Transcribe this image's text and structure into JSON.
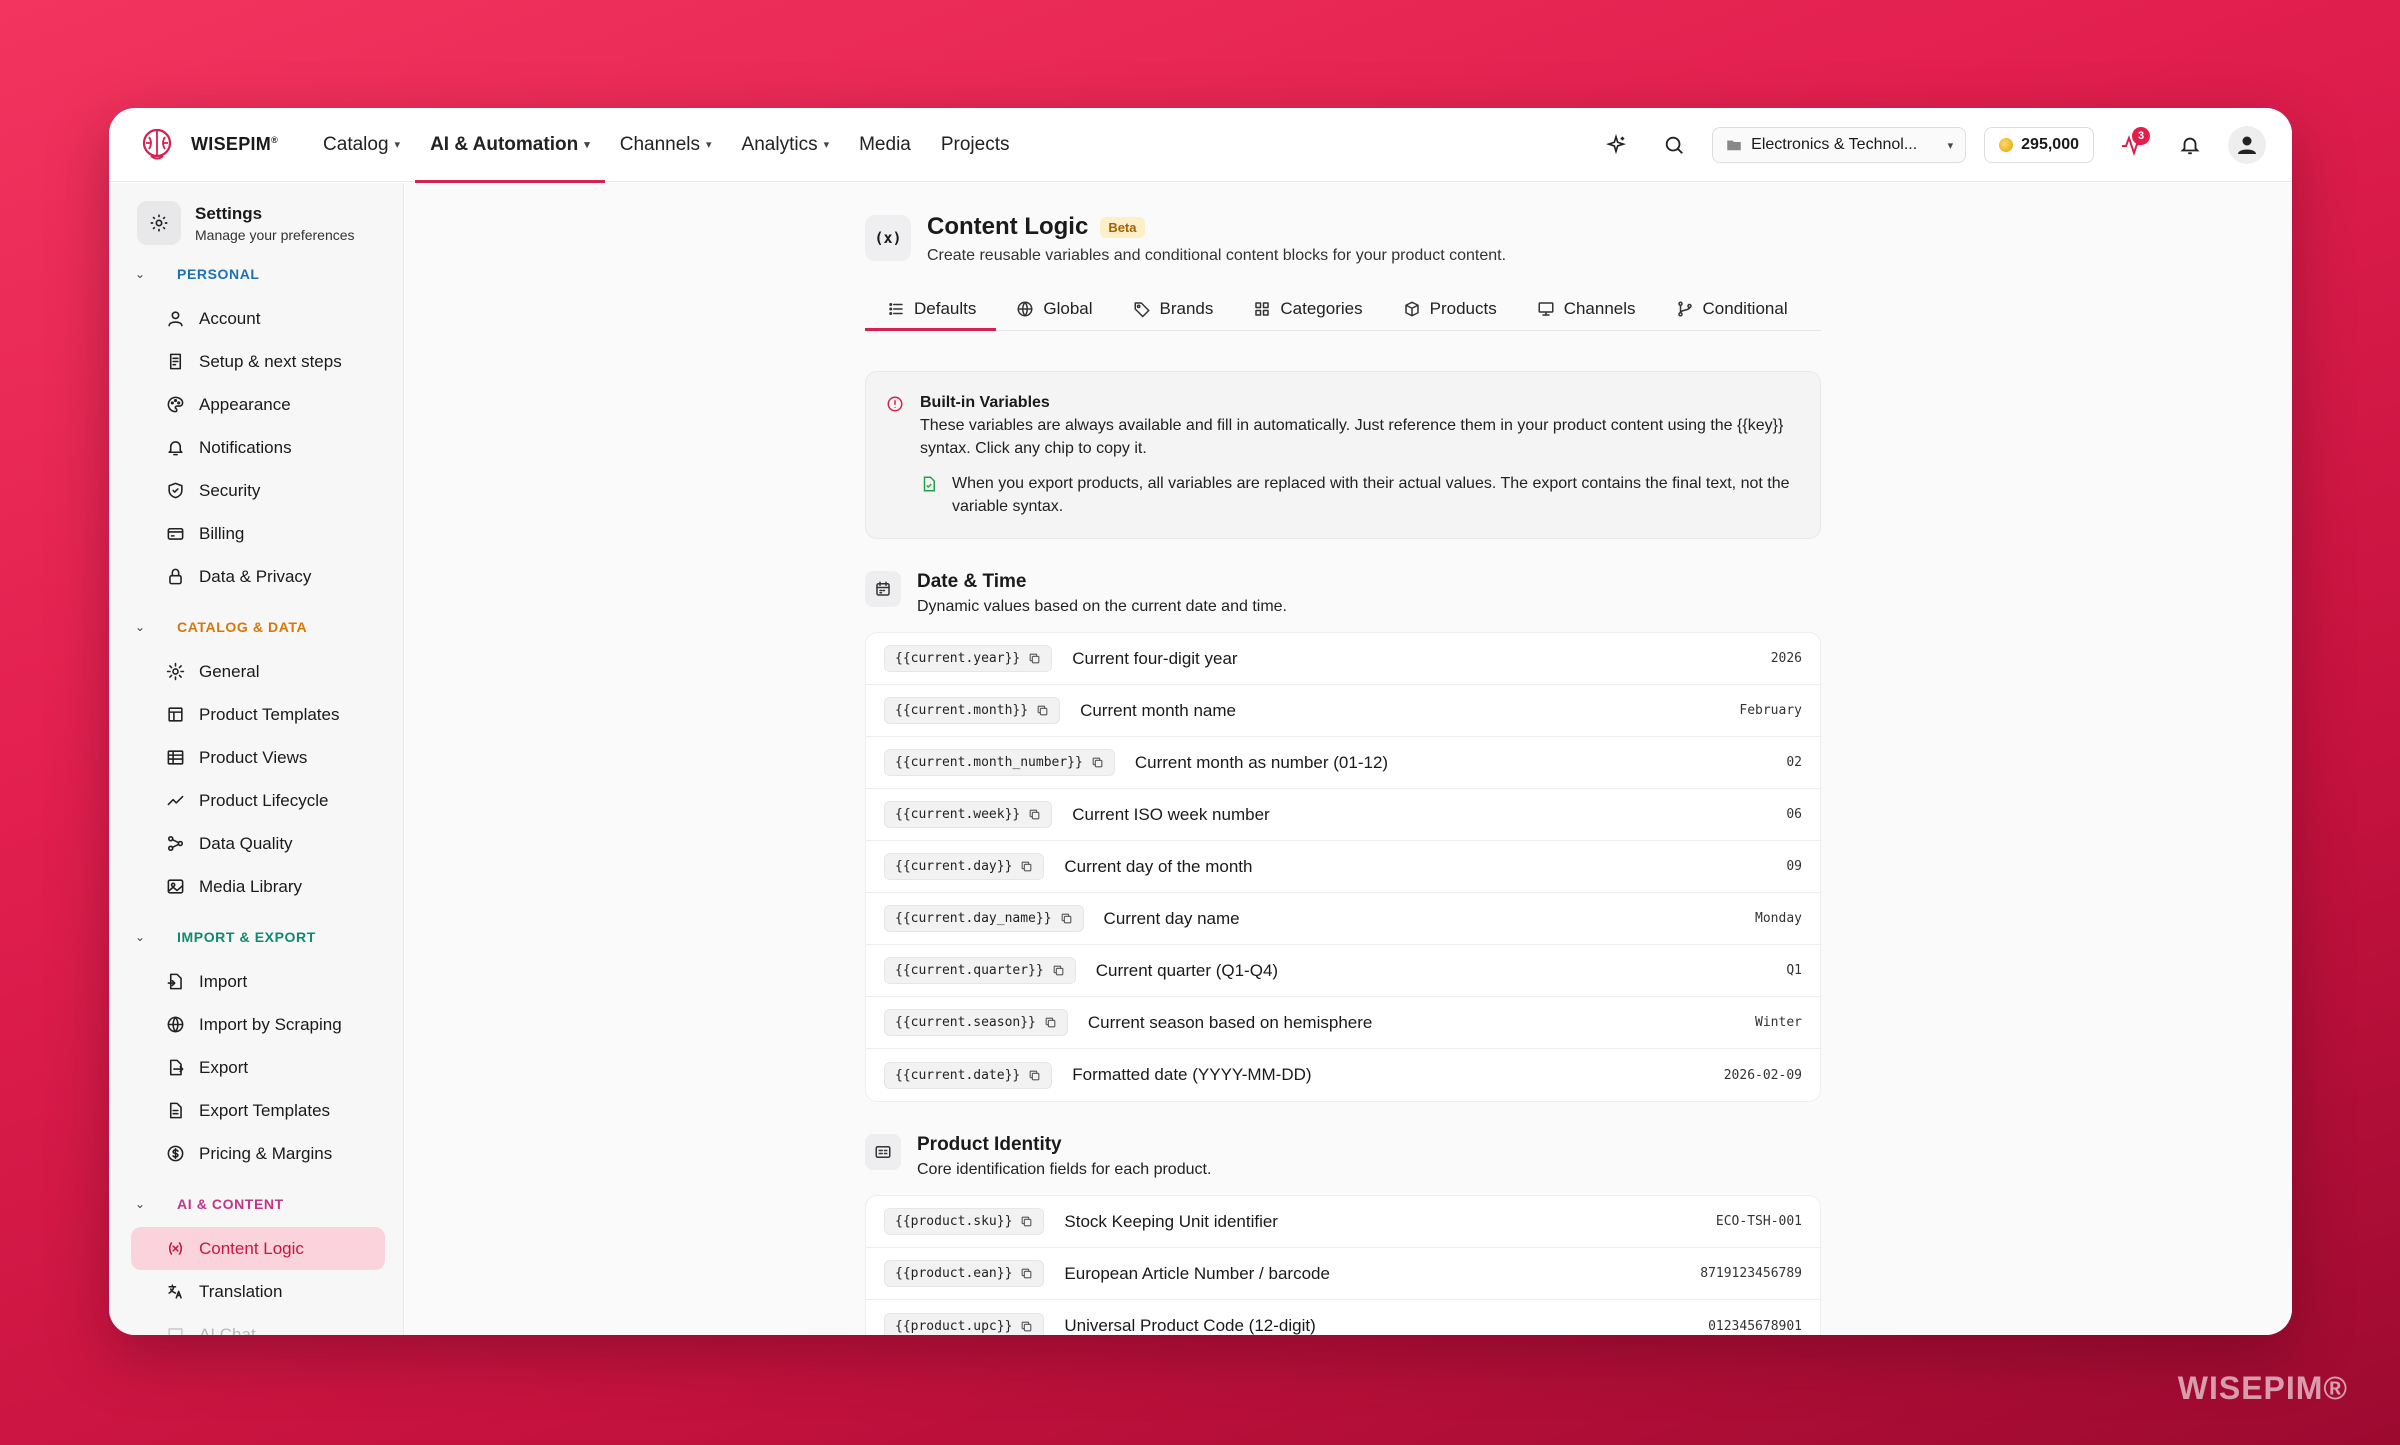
{
  "brand": {
    "name": "WISEPIM",
    "mark": "®",
    "accent": "#d6204f"
  },
  "nav": [
    {
      "label": "Catalog",
      "dropdown": true,
      "active": false
    },
    {
      "label": "AI & Automation",
      "dropdown": true,
      "active": true
    },
    {
      "label": "Channels",
      "dropdown": true,
      "active": false
    },
    {
      "label": "Analytics",
      "dropdown": true,
      "active": false
    },
    {
      "label": "Media",
      "dropdown": false,
      "active": false
    },
    {
      "label": "Projects",
      "dropdown": false,
      "active": false
    }
  ],
  "topbar": {
    "workspace": "Electronics & Technol...",
    "credits": "295,000",
    "activity_badge": "3"
  },
  "sidebar": {
    "title": "Settings",
    "subtitle": "Manage your preferences",
    "groups": [
      {
        "label": "PERSONAL",
        "color": "#1f6fb5",
        "items": [
          {
            "label": "Account",
            "icon": "user-icon"
          },
          {
            "label": "Setup & next steps",
            "icon": "checklist-icon"
          },
          {
            "label": "Appearance",
            "icon": "palette-icon"
          },
          {
            "label": "Notifications",
            "icon": "bell-icon"
          },
          {
            "label": "Security",
            "icon": "shield-icon"
          },
          {
            "label": "Billing",
            "icon": "credit-card-icon"
          },
          {
            "label": "Data & Privacy",
            "icon": "lock-icon"
          }
        ]
      },
      {
        "label": "CATALOG & DATA",
        "color": "#d97706",
        "items": [
          {
            "label": "General",
            "icon": "gear-icon"
          },
          {
            "label": "Product Templates",
            "icon": "template-icon"
          },
          {
            "label": "Product Views",
            "icon": "table-icon"
          },
          {
            "label": "Product Lifecycle",
            "icon": "trend-icon"
          },
          {
            "label": "Data Quality",
            "icon": "nodes-icon"
          },
          {
            "label": "Media Library",
            "icon": "image-icon"
          }
        ]
      },
      {
        "label": "IMPORT & EXPORT",
        "color": "#0f8a6e",
        "items": [
          {
            "label": "Import",
            "icon": "file-import-icon"
          },
          {
            "label": "Import by Scraping",
            "icon": "globe-icon"
          },
          {
            "label": "Export",
            "icon": "file-export-icon"
          },
          {
            "label": "Export Templates",
            "icon": "file-template-icon"
          },
          {
            "label": "Pricing & Margins",
            "icon": "dollar-icon"
          }
        ]
      },
      {
        "label": "AI & CONTENT",
        "color": "#c2368a",
        "items": [
          {
            "label": "Content Logic",
            "icon": "variable-icon",
            "active": true
          },
          {
            "label": "Translation",
            "icon": "translate-icon"
          },
          {
            "label": "AI Chat",
            "icon": "chat-icon",
            "faded": true
          }
        ]
      }
    ]
  },
  "page": {
    "icon_text": "(x)",
    "title": "Content Logic",
    "badge": "Beta",
    "subtitle": "Create reusable variables and conditional content blocks for your product content.",
    "tabs": [
      {
        "label": "Defaults",
        "icon": "list-icon",
        "active": true
      },
      {
        "label": "Global",
        "icon": "globe-icon"
      },
      {
        "label": "Brands",
        "icon": "tag-icon"
      },
      {
        "label": "Categories",
        "icon": "grid-icon"
      },
      {
        "label": "Products",
        "icon": "box-icon"
      },
      {
        "label": "Channels",
        "icon": "monitor-icon"
      },
      {
        "label": "Conditional",
        "icon": "branch-icon"
      }
    ],
    "info": {
      "title": "Built-in Variables",
      "text": "These variables are always available and fill in automatically. Just reference them in your product content using the {{key}} syntax. Click any chip to copy it.",
      "note": "When you export products, all variables are replaced with their actual values. The export contains the final text, not the variable syntax."
    },
    "sections": [
      {
        "title": "Date & Time",
        "subtitle": "Dynamic values based on the current date and time.",
        "icon": "calendar-icon",
        "rows": [
          {
            "key": "{{current.year}}",
            "desc": "Current four-digit year",
            "value": "2026"
          },
          {
            "key": "{{current.month}}",
            "desc": "Current month name",
            "value": "February"
          },
          {
            "key": "{{current.month_number}}",
            "desc": "Current month as number (01-12)",
            "value": "02"
          },
          {
            "key": "{{current.week}}",
            "desc": "Current ISO week number",
            "value": "06"
          },
          {
            "key": "{{current.day}}",
            "desc": "Current day of the month",
            "value": "09"
          },
          {
            "key": "{{current.day_name}}",
            "desc": "Current day name",
            "value": "Monday"
          },
          {
            "key": "{{current.quarter}}",
            "desc": "Current quarter (Q1-Q4)",
            "value": "Q1"
          },
          {
            "key": "{{current.season}}",
            "desc": "Current season based on hemisphere",
            "value": "Winter"
          },
          {
            "key": "{{current.date}}",
            "desc": "Formatted date (YYYY-MM-DD)",
            "value": "2026-02-09"
          }
        ]
      },
      {
        "title": "Product Identity",
        "subtitle": "Core identification fields for each product.",
        "icon": "id-card-icon",
        "rows": [
          {
            "key": "{{product.sku}}",
            "desc": "Stock Keeping Unit identifier",
            "value": "ECO-TSH-001"
          },
          {
            "key": "{{product.ean}}",
            "desc": "European Article Number / barcode",
            "value": "8719123456789"
          },
          {
            "key": "{{product.upc}}",
            "desc": "Universal Product Code (12-digit)",
            "value": "012345678901"
          }
        ]
      }
    ]
  },
  "watermark": "WISEPIM®"
}
